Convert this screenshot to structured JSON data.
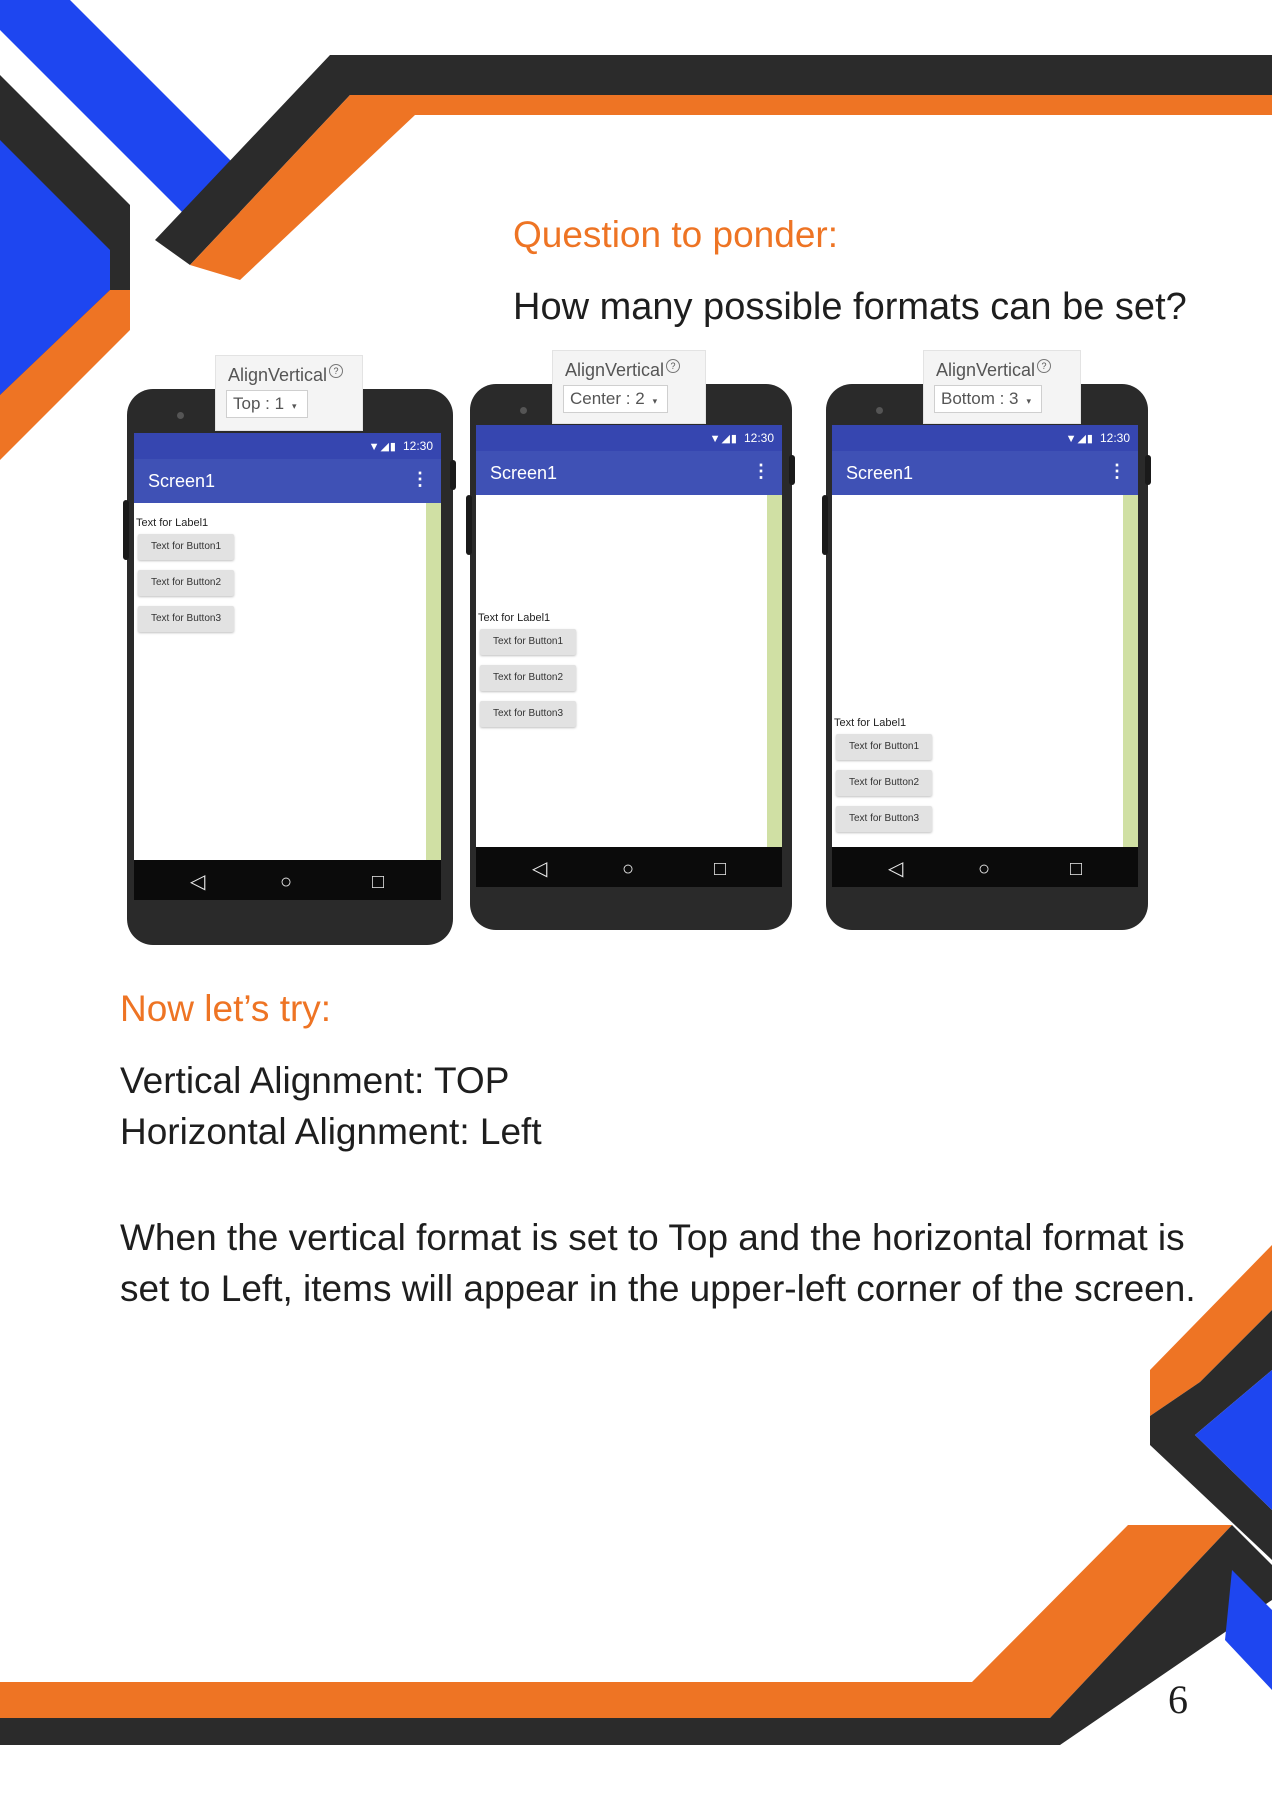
{
  "colors": {
    "orange": "#EE7424",
    "dark": "#2B2B2B",
    "blue": "#1E46F0",
    "app_bar": "#3F51B5",
    "scroll_track": "#D0E0A4"
  },
  "question": {
    "title": "Question to ponder:",
    "text": "How many possible formats can be set?"
  },
  "phones": [
    {
      "property_label": "AlignVertical",
      "help_icon": "?",
      "selected_value": "Top : 1",
      "dropdown_icon": "▾",
      "status_icons": "▼◢▮",
      "status_time": "12:30",
      "screen_title": "Screen1",
      "menu_icon": "⋮",
      "label": "Text for Label1",
      "buttons": [
        "Text for Button1",
        "Text for Button2",
        "Text for Button3"
      ],
      "nav_icons": [
        "◁",
        "○",
        "□"
      ]
    },
    {
      "property_label": "AlignVertical",
      "help_icon": "?",
      "selected_value": "Center : 2",
      "dropdown_icon": "▾",
      "status_icons": "▼◢▮",
      "status_time": "12:30",
      "screen_title": "Screen1",
      "menu_icon": "⋮",
      "label": "Text for Label1",
      "buttons": [
        "Text for Button1",
        "Text for Button2",
        "Text for Button3"
      ],
      "nav_icons": [
        "◁",
        "○",
        "□"
      ]
    },
    {
      "property_label": "AlignVertical",
      "help_icon": "?",
      "selected_value": "Bottom : 3",
      "dropdown_icon": "▾",
      "status_icons": "▼◢▮",
      "status_time": "12:30",
      "screen_title": "Screen1",
      "menu_icon": "⋮",
      "label": "Text for Label1",
      "buttons": [
        "Text for Button1",
        "Text for Button2",
        "Text for Button3"
      ],
      "nav_icons": [
        "◁",
        "○",
        "□"
      ]
    }
  ],
  "try_section": {
    "title": "Now let’s try:",
    "vertical": "Vertical Alignment: TOP",
    "horizontal": "Horizontal Alignment: Left",
    "paragraph": "When the vertical format is set to Top and the horizontal format is set to Left, items will appear in the upper-left corner of the screen."
  },
  "page_number": "6"
}
